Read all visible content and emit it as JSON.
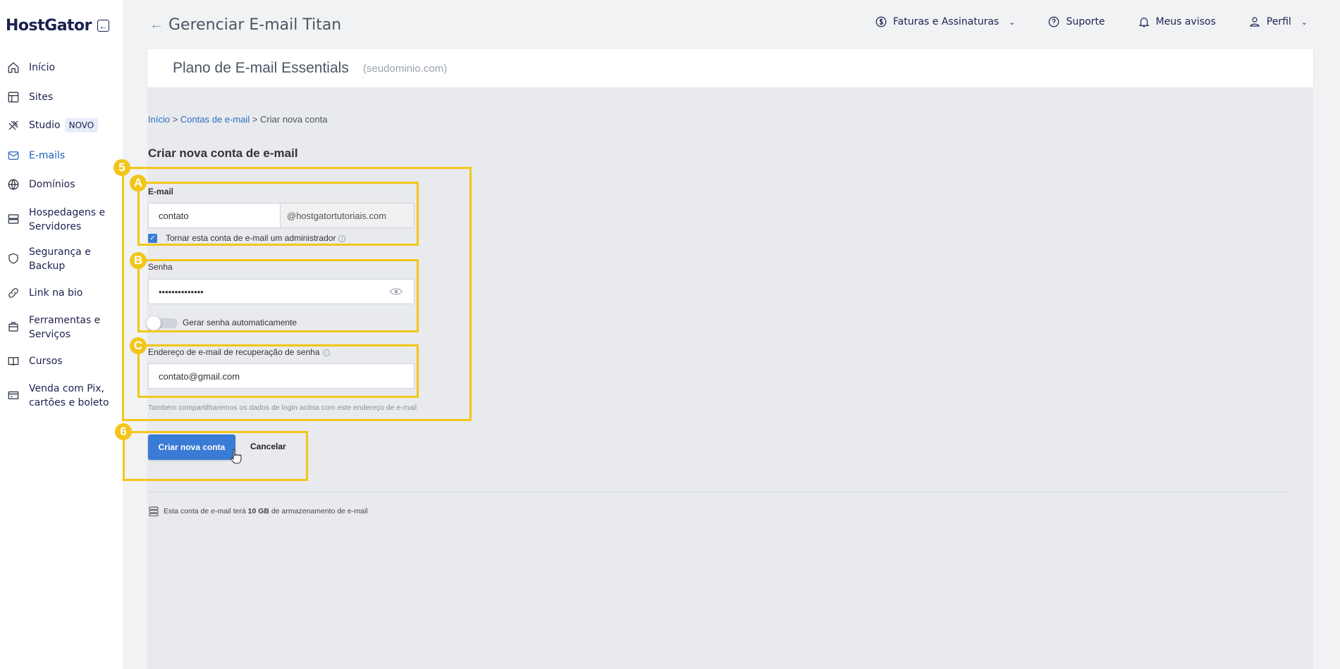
{
  "brand": {
    "name": "HostGator"
  },
  "sidebar": {
    "items": [
      {
        "label": "Início",
        "icon": "home-icon"
      },
      {
        "label": "Sites",
        "icon": "layout-icon"
      },
      {
        "label": "Studio",
        "icon": "studio-icon",
        "badge": "NOVO"
      },
      {
        "label": "E-mails",
        "icon": "mail-icon",
        "active": true
      },
      {
        "label": "Domínios",
        "icon": "globe-icon"
      },
      {
        "label": "Hospedagens e Servidores",
        "icon": "server-icon"
      },
      {
        "label": "Segurança e Backup",
        "icon": "shield-icon"
      },
      {
        "label": "Link na bio",
        "icon": "link-icon"
      },
      {
        "label": "Ferramentas e Serviços",
        "icon": "tools-icon"
      },
      {
        "label": "Cursos",
        "icon": "book-icon"
      },
      {
        "label": "Venda com Pix, cartões e boleto",
        "icon": "payment-icon"
      }
    ]
  },
  "header": {
    "title": "Gerenciar E-mail Titan",
    "actions": [
      {
        "label": "Faturas e Assinaturas",
        "icon": "dollar-icon",
        "has_caret": true
      },
      {
        "label": "Suporte",
        "icon": "help-icon"
      },
      {
        "label": "Meus avisos",
        "icon": "bell-icon"
      },
      {
        "label": "Perfil",
        "icon": "user-icon",
        "has_caret": true
      }
    ]
  },
  "plan": {
    "name": "Plano de E-mail Essentials",
    "domain": "(seudominio.com)"
  },
  "breadcrumb": {
    "home": "Início",
    "accounts": "Contas de e-mail",
    "current": "Criar nova conta",
    "separator": ">"
  },
  "form": {
    "title": "Criar nova conta de e-mail",
    "email_label": "E-mail",
    "email_value": "contato",
    "email_domain": "@hostgatortutoriais.com",
    "admin_checkbox_label": "Tornar esta conta de e-mail um administrador",
    "admin_checked": true,
    "password_label": "Senha",
    "password_value": "••••••••••••••",
    "auto_password_label": "Gerar senha automaticamente",
    "auto_password_on": false,
    "recovery_label": "Endereço de e-mail de recuperação de senha",
    "recovery_value": "contato@gmail.com",
    "hint": "Também compartilharemos os dados de login acima com este endereço de e-mail",
    "submit_label": "Criar nova conta",
    "cancel_label": "Cancelar"
  },
  "storage_note": {
    "prefix": "Esta conta de e-mail terá",
    "amount": "10 GB",
    "suffix": "de armazenamento de e-mail"
  },
  "annotations": {
    "step5": "5",
    "boxA": "A",
    "boxB": "B",
    "boxC": "C",
    "step6": "6"
  },
  "colors": {
    "accent": "#3a7bd5",
    "active_nav": "#2162b8",
    "annotation": "#f2c618",
    "brand": "#1b2250"
  }
}
